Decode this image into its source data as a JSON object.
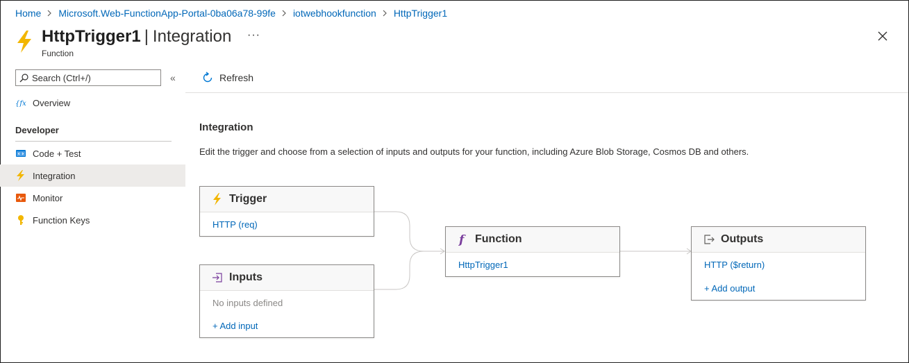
{
  "breadcrumb": {
    "items": [
      "Home",
      "Microsoft.Web-FunctionApp-Portal-0ba06a78-99fe",
      "iotwebhookfunction",
      "HttpTrigger1"
    ]
  },
  "header": {
    "title_bold": "HttpTrigger1",
    "title_sep": "|",
    "title_section": "Integration",
    "subtitle": "Function",
    "more": "···"
  },
  "sidebar": {
    "search_placeholder": "Search (Ctrl+/)",
    "collapse": "«",
    "overview": "Overview",
    "section_developer": "Developer",
    "items": [
      {
        "label": "Code + Test",
        "icon": "code-test-icon"
      },
      {
        "label": "Integration",
        "icon": "lightning-icon",
        "active": true
      },
      {
        "label": "Monitor",
        "icon": "monitor-icon"
      },
      {
        "label": "Function Keys",
        "icon": "key-icon"
      }
    ]
  },
  "toolbar": {
    "refresh": "Refresh"
  },
  "main": {
    "title": "Integration",
    "description": "Edit the trigger and choose from a selection of inputs and outputs for your function, including Azure Blob Storage, Cosmos DB and others."
  },
  "cards": {
    "trigger": {
      "title": "Trigger",
      "link": "HTTP (req)"
    },
    "inputs": {
      "title": "Inputs",
      "empty": "No inputs defined",
      "add": "+ Add input"
    },
    "function": {
      "title": "Function",
      "link": "HttpTrigger1"
    },
    "outputs": {
      "title": "Outputs",
      "link": "HTTP ($return)",
      "add": "+ Add output"
    }
  },
  "colors": {
    "link": "#0067b8",
    "accent_lightning": "#f2b600",
    "function_purple": "#7a3e9d",
    "active_bg": "#edebe9"
  }
}
